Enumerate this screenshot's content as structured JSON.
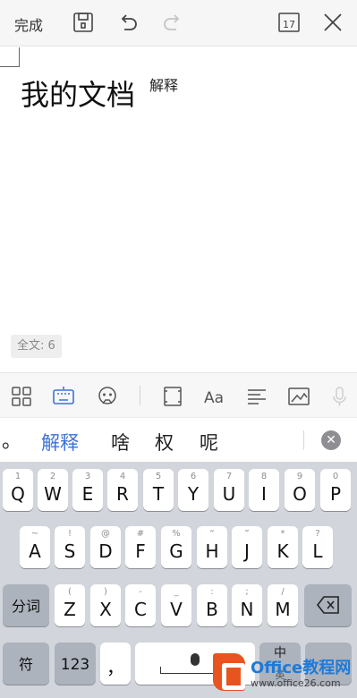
{
  "topbar": {
    "done_label": "完成",
    "save_icon": "save-icon",
    "undo_icon": "undo-icon",
    "redo_icon": "redo-icon",
    "calendar_value": "17",
    "close_icon": "close-icon"
  },
  "document": {
    "title": "我的文档",
    "annotation": "解释",
    "word_count": "全文: 6"
  },
  "edit_toolbar": {
    "icons": [
      "layout-icon",
      "keyboard-icon",
      "emoji-icon",
      "page-icon",
      "font-icon",
      "align-icon",
      "image-icon",
      "mic-icon"
    ],
    "active_color": "#3a73d9"
  },
  "candidates": {
    "punct": "。",
    "words": [
      "解释",
      "啥",
      "权",
      "呢"
    ],
    "highlight_color": "#3a73d9"
  },
  "keyboard": {
    "row1": [
      {
        "sub": "1",
        "main": "Q"
      },
      {
        "sub": "2",
        "main": "W"
      },
      {
        "sub": "3",
        "main": "E"
      },
      {
        "sub": "4",
        "main": "R"
      },
      {
        "sub": "5",
        "main": "T"
      },
      {
        "sub": "6",
        "main": "Y"
      },
      {
        "sub": "7",
        "main": "U"
      },
      {
        "sub": "8",
        "main": "I"
      },
      {
        "sub": "9",
        "main": "O"
      },
      {
        "sub": "0",
        "main": "P"
      }
    ],
    "row2": [
      {
        "sub": "~",
        "main": "A"
      },
      {
        "sub": "!",
        "main": "S"
      },
      {
        "sub": "@",
        "main": "D"
      },
      {
        "sub": "#",
        "main": "F"
      },
      {
        "sub": "%",
        "main": "G"
      },
      {
        "sub": "“",
        "main": "H"
      },
      {
        "sub": "”",
        "main": "J"
      },
      {
        "sub": "*",
        "main": "K"
      },
      {
        "sub": "?",
        "main": "L"
      }
    ],
    "row3": [
      {
        "sub": "(",
        "main": "Z"
      },
      {
        "sub": ")",
        "main": "X"
      },
      {
        "sub": "-",
        "main": "C"
      },
      {
        "sub": "_",
        "main": "V"
      },
      {
        "sub": ":",
        "main": "B"
      },
      {
        "sub": ";",
        "main": "N"
      },
      {
        "sub": "/",
        "main": "M"
      }
    ],
    "fenci_label": "分词",
    "symbol_label": "符",
    "num_label": "123",
    "comma_label": "，",
    "zh_label": "中",
    "zh_sub": "英"
  },
  "watermark": {
    "title": "Office教程网",
    "url": "www.office26.com"
  }
}
